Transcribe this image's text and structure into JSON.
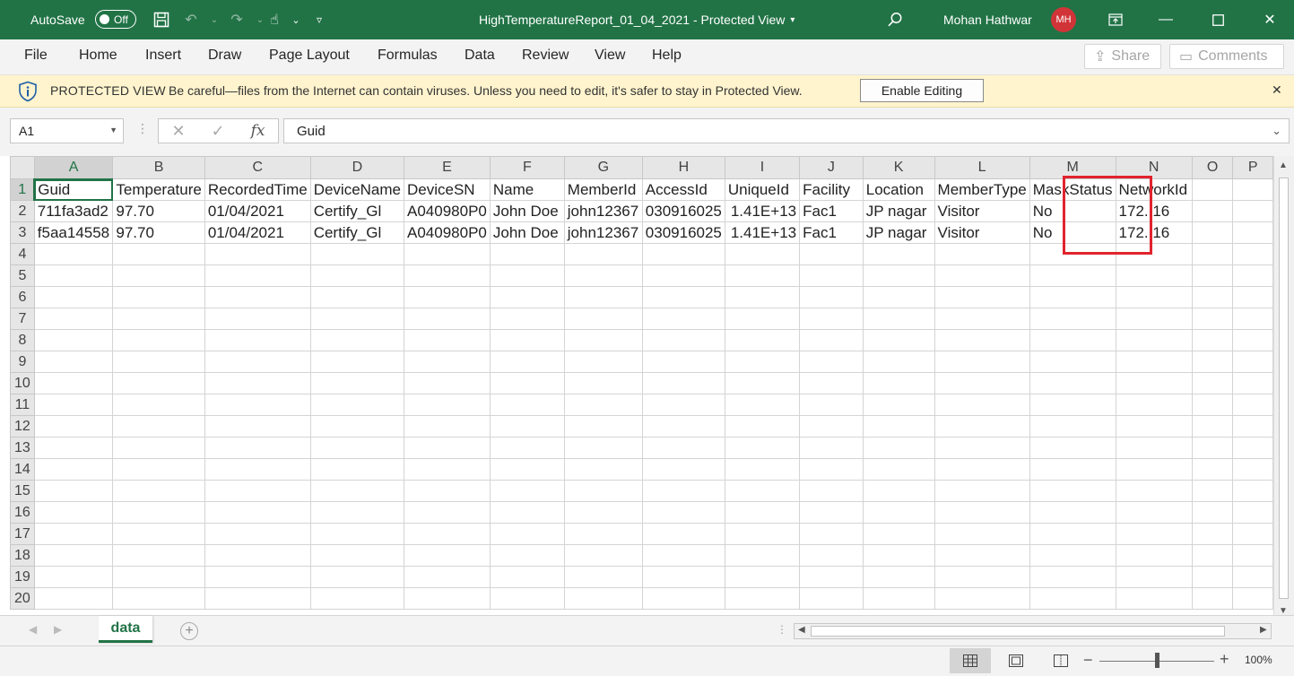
{
  "titlebar": {
    "autosave_label": "AutoSave",
    "autosave_state": "Off",
    "document_title": "HighTemperatureReport_01_04_2021  -  Protected View",
    "user_name": "Mohan Hathwar",
    "user_initials": "MH",
    "accent_color": "#217346"
  },
  "menu": {
    "items": [
      "File",
      "Home",
      "Insert",
      "Draw",
      "Page Layout",
      "Formulas",
      "Data",
      "Review",
      "View",
      "Help"
    ],
    "share_label": "Share",
    "comments_label": "Comments"
  },
  "protected_view": {
    "title": "PROTECTED VIEW",
    "message": "Be careful—files from the Internet can contain viruses. Unless you need to edit, it's safer to stay in Protected View.",
    "enable_button": "Enable Editing",
    "background_color": "#fff4ce"
  },
  "formula_bar": {
    "name_box": "A1",
    "formula": "Guid"
  },
  "sheet": {
    "columns": [
      "A",
      "B",
      "C",
      "D",
      "E",
      "F",
      "G",
      "H",
      "I",
      "J",
      "K",
      "L",
      "M",
      "N",
      "O",
      "P"
    ],
    "rows": [
      [
        "Guid",
        "Temperature",
        "RecordedTime",
        "DeviceName",
        "DeviceSN",
        "Name",
        "MemberId",
        "AccessId",
        "UniqueId",
        "Facility",
        "Location",
        "MemberType",
        "MaskStatus",
        "NetworkId",
        "",
        ""
      ],
      [
        "711fa3ad2",
        "97.70",
        "01/04/2021",
        "Certify_Gl",
        "A040980P0",
        "John Doe",
        "john12367",
        "030916025",
        "1.41E+13",
        "Fac1",
        "JP nagar",
        "Visitor",
        "No",
        "172..16",
        "",
        ""
      ],
      [
        "f5aa14558",
        "97.70",
        "01/04/2021",
        "Certify_Gl",
        "A040980P0",
        "John Doe",
        "john12367",
        "030916025",
        "1.41E+13",
        "Fac1",
        "JP nagar",
        "Visitor",
        "No",
        "172..16",
        "",
        ""
      ]
    ],
    "total_rows": 20
  },
  "tabs": {
    "sheets": [
      "data"
    ],
    "active": "data"
  },
  "status": {
    "zoom_level": "100%",
    "zoom_fraction": 0.5
  }
}
